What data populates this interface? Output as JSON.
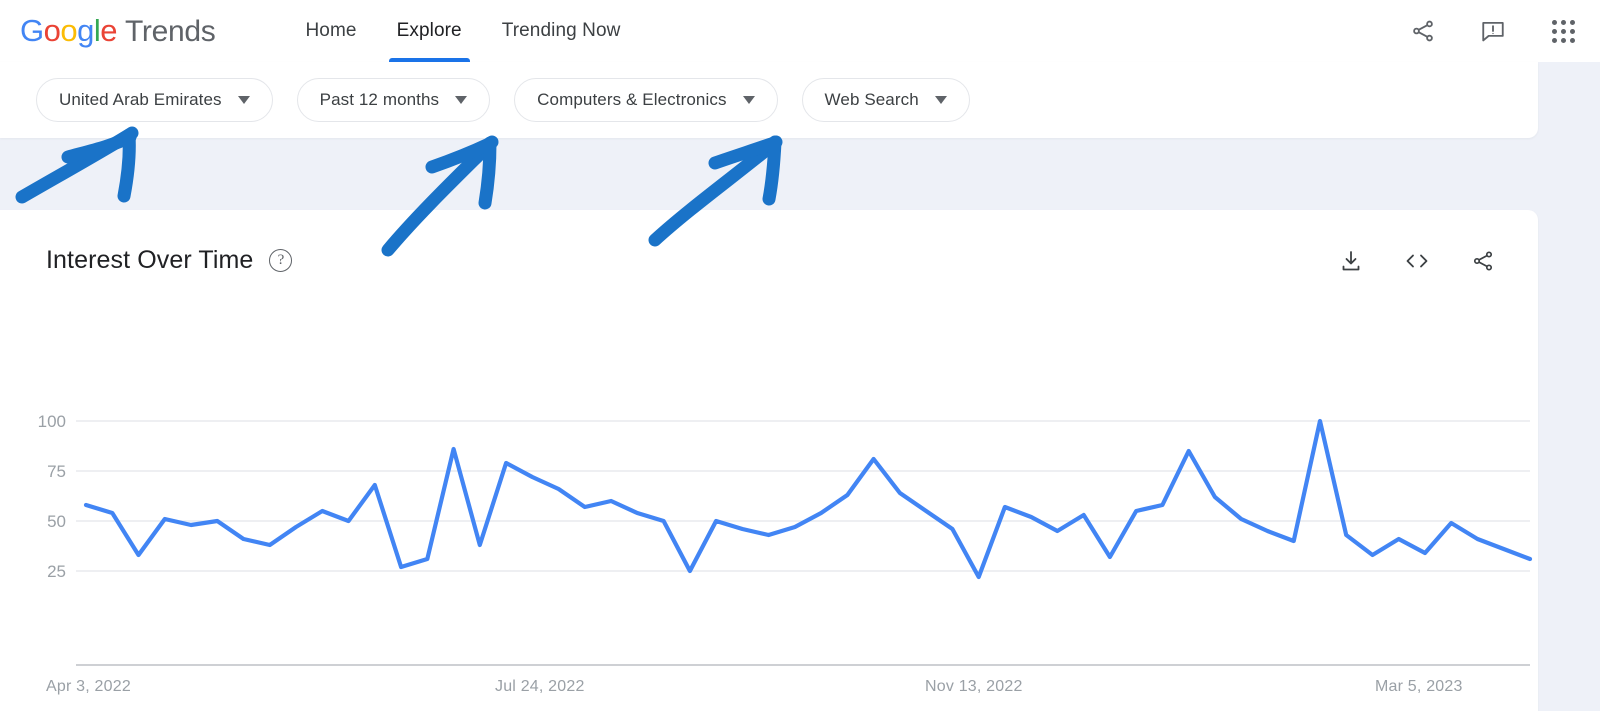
{
  "header": {
    "logo_parts": [
      "G",
      "o",
      "o",
      "g",
      "l",
      "e"
    ],
    "brand_suffix": "Trends",
    "nav": [
      {
        "label": "Home",
        "active": false
      },
      {
        "label": "Explore",
        "active": true
      },
      {
        "label": "Trending Now",
        "active": false
      }
    ],
    "icons": [
      "share-icon",
      "feedback-icon",
      "apps-grid-icon"
    ]
  },
  "filters": [
    {
      "label": "United Arab Emirates",
      "name": "location-filter"
    },
    {
      "label": "Past 12 months",
      "name": "time-range-filter"
    },
    {
      "label": "Computers & Electronics",
      "name": "category-filter"
    },
    {
      "label": "Web Search",
      "name": "search-type-filter"
    }
  ],
  "card": {
    "title": "Interest Over Time",
    "help_glyph": "?",
    "actions": [
      "download-icon",
      "embed-code-icon",
      "share-icon"
    ]
  },
  "colors": {
    "line": "#4285f4",
    "accent": "#1a73e8",
    "annotation": "#1a73c8",
    "grid": "#e8eaed",
    "axis_text": "#9aa0a6",
    "page_bg": "#eef1f8"
  },
  "annotations": {
    "count": 3,
    "description": "three hand-drawn blue arrows pointing up-right at the first three filter chips",
    "color": "#1a73c8"
  },
  "chart_data": {
    "type": "line",
    "title": "Interest Over Time",
    "xlabel": "",
    "ylabel": "",
    "ylim": [
      0,
      100
    ],
    "yticks": [
      25,
      50,
      75,
      100
    ],
    "grid": true,
    "legend": "none",
    "line_color": "#4285f4",
    "xtick_labels": [
      "Apr 3, 2022",
      "Jul 24, 2022",
      "Nov 13, 2022",
      "Mar 5, 2023"
    ],
    "xtick_positions": [
      0,
      16,
      32,
      48
    ],
    "x_count": 53,
    "values": [
      58,
      54,
      33,
      51,
      48,
      50,
      41,
      38,
      47,
      55,
      50,
      68,
      27,
      31,
      86,
      38,
      79,
      72,
      66,
      57,
      60,
      54,
      50,
      25,
      50,
      46,
      43,
      47,
      54,
      63,
      81,
      64,
      55,
      46,
      22,
      57,
      52,
      45,
      53,
      32,
      55,
      58,
      85,
      62,
      51,
      45,
      40,
      100,
      43,
      33,
      41,
      34,
      49,
      41,
      36,
      31
    ]
  }
}
